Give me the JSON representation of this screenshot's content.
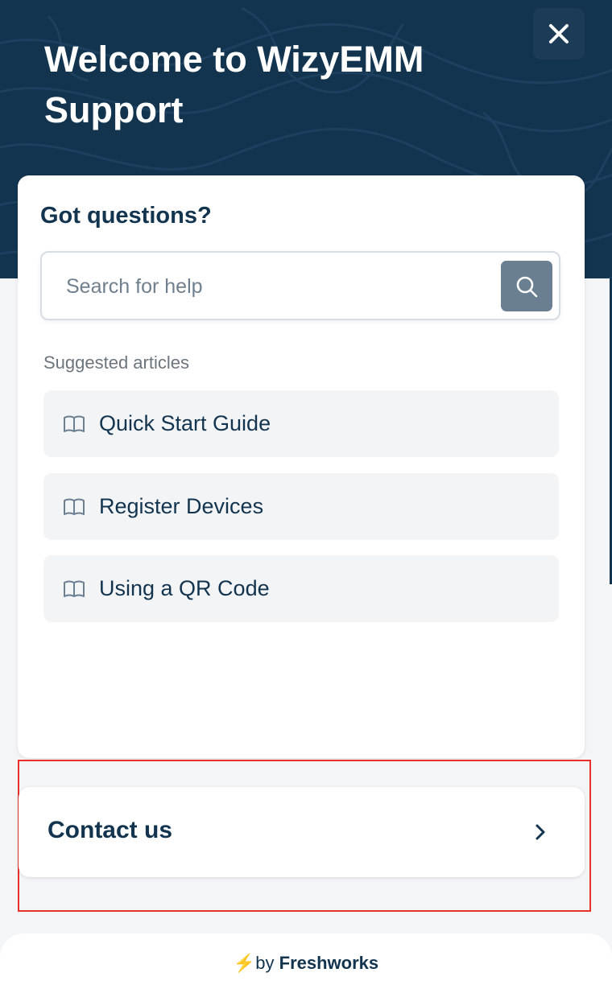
{
  "header": {
    "title": "Welcome to WizyEMM Support",
    "close_icon": "close-icon"
  },
  "card": {
    "title": "Got questions?",
    "search": {
      "placeholder": "Search for help",
      "value": "",
      "icon": "search-icon"
    },
    "suggested_label": "Suggested articles",
    "articles": [
      {
        "label": "Quick Start Guide",
        "icon": "book-icon"
      },
      {
        "label": "Register Devices",
        "icon": "book-icon"
      },
      {
        "label": "Using a QR Code",
        "icon": "book-icon"
      }
    ]
  },
  "contact": {
    "label": "Contact us",
    "icon": "chevron-right-icon"
  },
  "footer": {
    "bolt": "⚡",
    "by": "by",
    "brand": "Freshworks"
  },
  "colors": {
    "header_bg": "#13344f",
    "text_primary": "#13344f",
    "search_button": "#6b7f92",
    "highlight_border": "#e8312a",
    "bolt": "#f3b21a"
  }
}
